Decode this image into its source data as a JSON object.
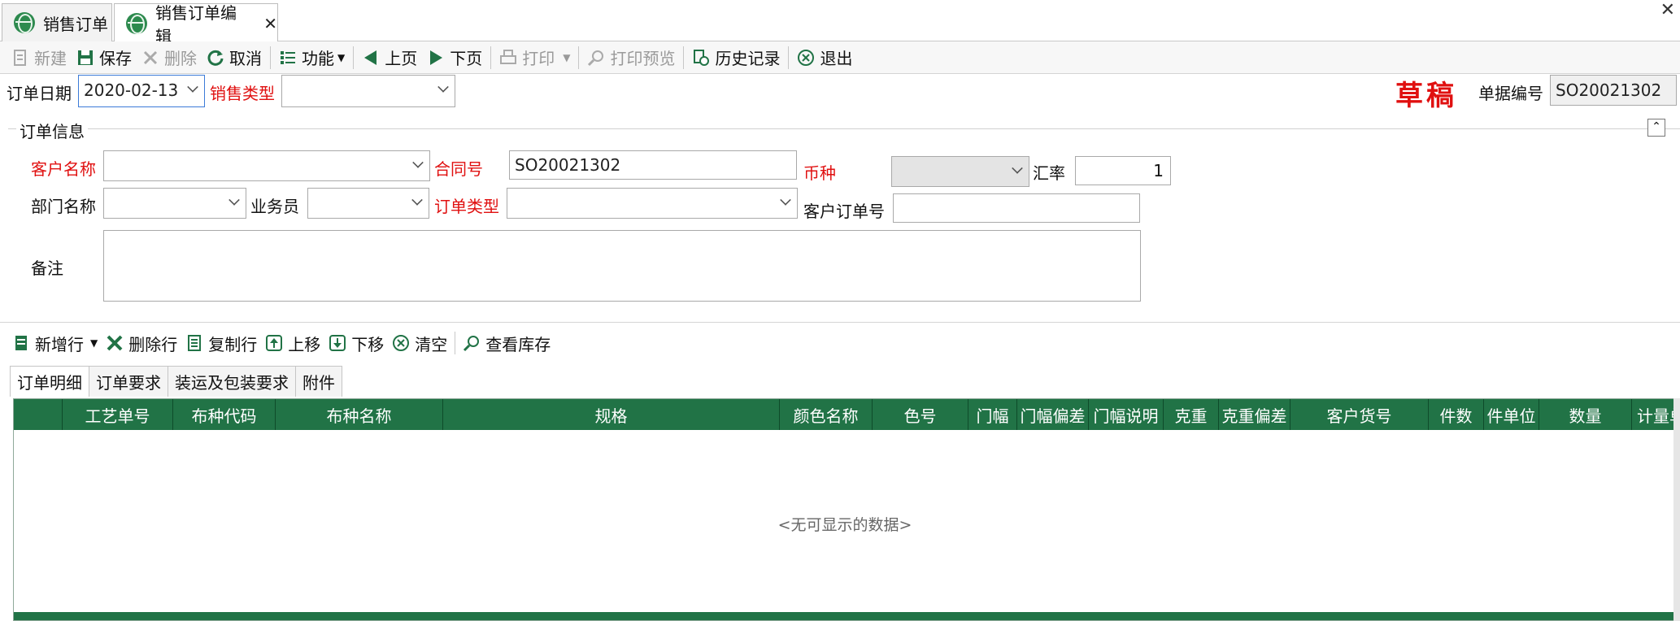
{
  "tabs": [
    {
      "label": "销售订单"
    },
    {
      "label": "销售订单编辑"
    }
  ],
  "toolbar": {
    "new": "新建",
    "save": "保存",
    "delete": "删除",
    "cancel": "取消",
    "func": "功能",
    "prev": "上页",
    "next": "下页",
    "print": "打印",
    "preview": "打印预览",
    "history": "历史记录",
    "exit": "退出"
  },
  "header": {
    "order_date_label": "订单日期",
    "order_date_value": "2020-02-13",
    "sale_type_label": "销售类型",
    "sale_type_value": "",
    "status": "草稿",
    "doc_no_label": "单据编号",
    "doc_no_value": "SO20021302"
  },
  "group": {
    "title": "订单信息",
    "customer_label": "客户名称",
    "customer_value": "",
    "contract_label": "合同号",
    "contract_value": "SO20021302",
    "currency_label": "币种",
    "currency_value": "",
    "rate_label": "汇率",
    "rate_value": "1",
    "dept_label": "部门名称",
    "dept_value": "",
    "salesman_label": "业务员",
    "salesman_value": "",
    "order_type_label": "订单类型",
    "order_type_value": "",
    "cust_order_label": "客户订单号",
    "cust_order_value": "",
    "remark_label": "备注",
    "remark_value": ""
  },
  "grid_toolbar": {
    "add_row": "新增行",
    "del_row": "删除行",
    "copy_row": "复制行",
    "move_up": "上移",
    "move_down": "下移",
    "clear": "清空",
    "stock": "查看库存"
  },
  "subtabs": [
    {
      "label": "订单明细"
    },
    {
      "label": "订单要求"
    },
    {
      "label": "装运及包装要求"
    },
    {
      "label": "附件"
    }
  ],
  "grid": {
    "columns": [
      "",
      "工艺单号",
      "布种代码",
      "布种名称",
      "规格",
      "颜色名称",
      "色号",
      "门幅",
      "门幅偏差",
      "门幅说明",
      "克重",
      "克重偏差",
      "客户货号",
      "件数",
      "件单位",
      "数量",
      "计量单"
    ],
    "empty_text": "<无可显示的数据>"
  },
  "colors": {
    "accent": "#217346",
    "required": "#e01010"
  }
}
